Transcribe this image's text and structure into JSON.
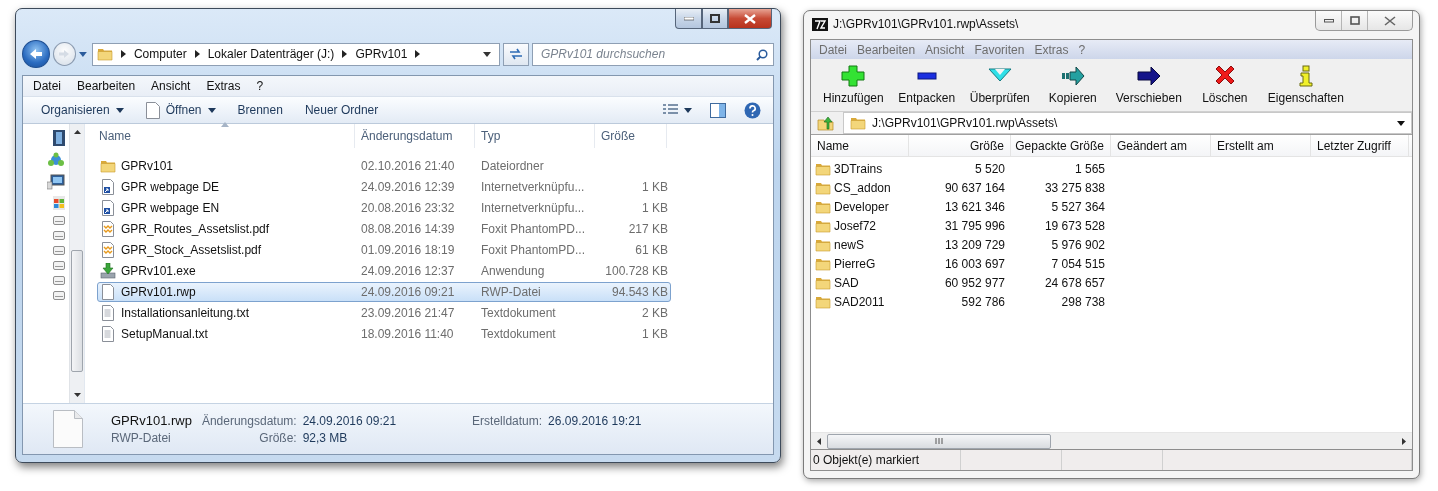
{
  "explorer": {
    "breadcrumb": [
      "Computer",
      "Lokaler Datenträger (J:)",
      "GPRv101"
    ],
    "search": {
      "placeholder": "GPRv101 durchsuchen"
    },
    "menu": [
      "Datei",
      "Bearbeiten",
      "Ansicht",
      "Extras",
      "?"
    ],
    "commands": [
      {
        "label": "Organisieren",
        "kind": "menu"
      },
      {
        "label": "Öffnen",
        "kind": "open"
      },
      {
        "label": "Brennen",
        "kind": "plain"
      },
      {
        "label": "Neuer Ordner",
        "kind": "plain"
      }
    ],
    "columns": [
      "Name",
      "Änderungsdatum",
      "Typ",
      "Größe"
    ],
    "files": [
      {
        "name": "GPRv101",
        "date": "02.10.2016 21:40",
        "type": "Dateiordner",
        "kind": "folder",
        "selected": false
      },
      {
        "name": "GPR webpage DE",
        "date": "24.09.2016 12:39",
        "type": "Internetverknüpfu...",
        "size": "1 KB",
        "kind": "link",
        "selected": false
      },
      {
        "name": "GPR webpage EN",
        "date": "20.08.2016 23:32",
        "type": "Internetverknüpfu...",
        "size": "1 KB",
        "kind": "link",
        "selected": false
      },
      {
        "name": "GPR_Routes_Assetslist.pdf",
        "date": "08.08.2016 14:39",
        "type": "Foxit PhantomPD...",
        "size": "217 KB",
        "kind": "pdf",
        "selected": false
      },
      {
        "name": "GPR_Stock_Assetslist.pdf",
        "date": "01.09.2016 18:19",
        "type": "Foxit PhantomPD...",
        "size": "61 KB",
        "kind": "pdf",
        "selected": false
      },
      {
        "name": "GPRv101.exe",
        "date": "24.09.2016 12:37",
        "type": "Anwendung",
        "size": "100.728 KB",
        "kind": "exe",
        "selected": false
      },
      {
        "name": "GPRv101.rwp",
        "date": "24.09.2016 09:21",
        "type": "RWP-Datei",
        "size": "94.543 KB",
        "kind": "file",
        "selected": true
      },
      {
        "name": "Installationsanleitung.txt",
        "date": "23.09.2016 21:47",
        "type": "Textdokument",
        "size": "2 KB",
        "kind": "text",
        "selected": false
      },
      {
        "name": "SetupManual.txt",
        "date": "18.09.2016 11:40",
        "type": "Textdokument",
        "size": "1 KB",
        "kind": "text",
        "selected": false
      }
    ],
    "details": {
      "name": "GPRv101.rwp",
      "type": "RWP-Datei",
      "fields": [
        {
          "label": "Änderungsdatum:",
          "value": "24.09.2016 09:21"
        },
        {
          "label": "Erstelldatum:",
          "value": "26.09.2016 19:21"
        },
        {
          "label": "Größe:",
          "value": "92,3 MB"
        }
      ]
    }
  },
  "sevenzip": {
    "title": "J:\\GPRv101\\GPRv101.rwp\\Assets\\",
    "menu": [
      "Datei",
      "Bearbeiten",
      "Ansicht",
      "Favoriten",
      "Extras",
      "?"
    ],
    "toolbar": [
      {
        "label": "Hinzufügen",
        "kind": "add"
      },
      {
        "label": "Entpacken",
        "kind": "extract"
      },
      {
        "label": "Überprüfen",
        "kind": "test"
      },
      {
        "label": "Kopieren",
        "kind": "copy"
      },
      {
        "label": "Verschieben",
        "kind": "move"
      },
      {
        "label": "Löschen",
        "kind": "delete"
      },
      {
        "label": "Eigenschaften",
        "kind": "info"
      }
    ],
    "path": "J:\\GPRv101\\GPRv101.rwp\\Assets\\",
    "columns": [
      "Name",
      "Größe",
      "Gepackte Größe",
      "Geändert am",
      "Erstellt am",
      "Letzter Zugriff"
    ],
    "rows": [
      {
        "name": "3DTrains",
        "size": "5 520",
        "packed": "1 565"
      },
      {
        "name": "CS_addon",
        "size": "90 637 164",
        "packed": "33 275 838"
      },
      {
        "name": "Developer",
        "size": "13 621 346",
        "packed": "5 527 364"
      },
      {
        "name": "Josef72",
        "size": "31 795 996",
        "packed": "19 673 528"
      },
      {
        "name": "newS",
        "size": "13 209 729",
        "packed": "5 976 902"
      },
      {
        "name": "PierreG",
        "size": "16 003 697",
        "packed": "7 054 515"
      },
      {
        "name": "SAD",
        "size": "60 952 977",
        "packed": "24 678 657"
      },
      {
        "name": "SAD2011",
        "size": "592 786",
        "packed": "298 738"
      }
    ],
    "status": "0 Objekt(e) markiert"
  }
}
